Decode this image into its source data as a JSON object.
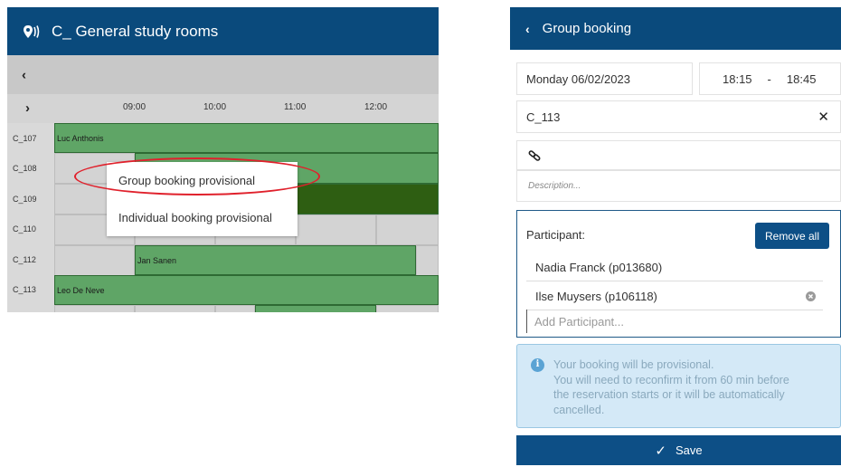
{
  "left_panel": {
    "title": "C_ General study rooms",
    "prev_label": "‹",
    "next_label": "›",
    "times": [
      "09:00",
      "10:00",
      "11:00",
      "12:00"
    ],
    "rooms": [
      "C_107",
      "C_108",
      "C_109",
      "C_110",
      "C_112",
      "C_113"
    ],
    "bookings": {
      "c107": "Luc Anthonis",
      "c112": "Jan Sanen",
      "c113": "Leo De Neve"
    },
    "context_menu": {
      "item_group": "Group booking provisional",
      "item_individual": "Individual booking provisional"
    },
    "highlight_color": "#e0212c",
    "booking_color": "#5fa566",
    "booking_dark_color": "#2e5e12"
  },
  "right_panel": {
    "title": "Group booking",
    "back_label": "‹",
    "date": "Monday 06/02/2023",
    "time_start": "18:15",
    "time_sep": "-",
    "time_end": "18:45",
    "room": "C_113",
    "clear_label": "✕",
    "description_placeholder": "Description...",
    "participant_label": "Participant:",
    "remove_all_label": "Remove all",
    "participants": [
      "Nadia Franck (p013680)",
      "Ilse Muysers (p106118)"
    ],
    "add_participant_placeholder": "Add Participant...",
    "info_lines": [
      "Your booking will be provisional.",
      "You will need to reconfirm it from 60 min before",
      "the reservation starts or it will be automatically",
      "cancelled."
    ],
    "save_label": "Save",
    "accent_color": "#0a4a7c"
  }
}
